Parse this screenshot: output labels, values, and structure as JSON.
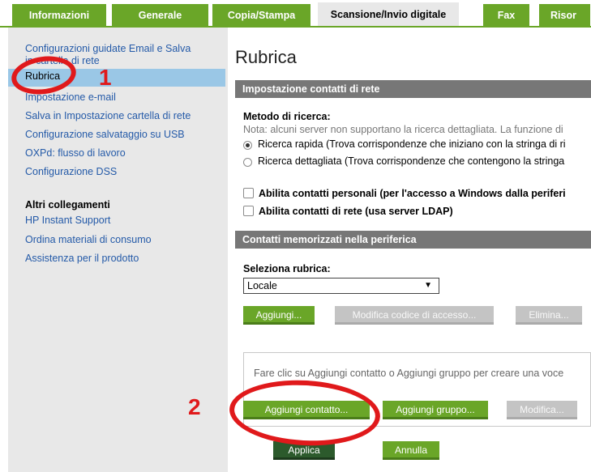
{
  "tabs": [
    {
      "label": "Informazioni"
    },
    {
      "label": "Generale"
    },
    {
      "label": "Copia/Stampa"
    },
    {
      "label": "Scansione/Invio digitale"
    },
    {
      "label": "Fax"
    },
    {
      "label": "Risor"
    }
  ],
  "sidebar": {
    "items": [
      {
        "label": "Configurazioni guidate Email e Salva"
      },
      {
        "label": "in cartella di rete"
      },
      {
        "label": "Rubrica"
      },
      {
        "label": "Impostazione e-mail"
      },
      {
        "label": "Salva in Impostazione cartella di rete"
      },
      {
        "label": "Configurazione salvataggio su USB"
      },
      {
        "label": "OXPd: flusso di lavoro"
      },
      {
        "label": "Configurazione DSS"
      }
    ],
    "other_heading": "Altri collegamenti",
    "other_links": [
      {
        "label": "HP Instant Support"
      },
      {
        "label": "Ordina materiali di consumo"
      },
      {
        "label": "Assistenza per il prodotto"
      }
    ]
  },
  "main": {
    "title": "Rubrica",
    "section1": "Impostazione contatti di rete",
    "search_method": "Metodo di ricerca:",
    "note": "Nota: alcuni server non supportano la ricerca dettagliata. La funzione di",
    "radio1": "Ricerca rapida (Trova corrispondenze che iniziano con la stringa di ri",
    "radio2": "Ricerca dettagliata (Trova corrispondenze che contengono la stringa",
    "check1": "Abilita contatti personali (per l'accesso a Windows dalla periferi",
    "check2": "Abilita contatti di rete (usa server LDAP)",
    "section2": "Contatti memorizzati nella periferica",
    "select_label": "Seleziona rubrica:",
    "select_value": "Locale",
    "btn_add": "Aggiungi...",
    "btn_modify_code": "Modifica codice di accesso...",
    "btn_delete": "Elimina...",
    "box_text": "Fare clic su Aggiungi contatto o Aggiungi gruppo per creare una voce",
    "btn_add_contact": "Aggiungi contatto...",
    "btn_add_group": "Aggiungi gruppo...",
    "btn_modify": "Modifica...",
    "btn_apply": "Applica",
    "btn_cancel": "Annulla"
  },
  "annotations": {
    "one": "1",
    "two": "2"
  },
  "colors": {
    "green": "#6aa628",
    "red": "#e0191b",
    "gray_header": "#777777",
    "selection": "#9ac7e6"
  }
}
